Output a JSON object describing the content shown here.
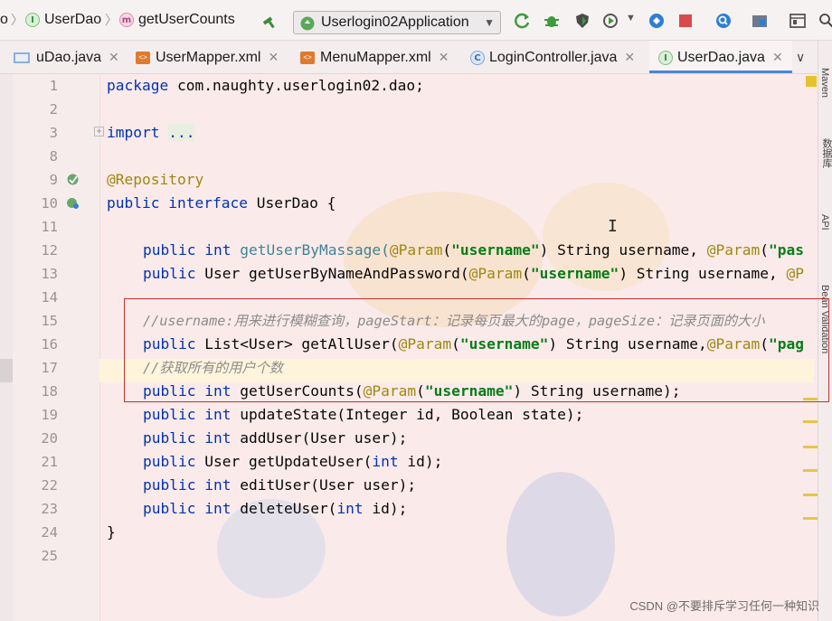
{
  "navbar": {
    "crumb_prefix": "o",
    "crumb_interface": "UserDao",
    "crumb_interface_icon": "I",
    "crumb_method": "getUserCounts",
    "crumb_method_icon": "m",
    "run_config": "Userlogin02Application"
  },
  "tabs": [
    {
      "label": "uDao.java",
      "icon": "java-file-icon"
    },
    {
      "label": "UserMapper.xml",
      "icon": "xml-file-icon"
    },
    {
      "label": "MenuMapper.xml",
      "icon": "xml-file-icon"
    },
    {
      "label": "LoginController.java",
      "icon": "class-icon",
      "icon_letter": "C"
    },
    {
      "label": "UserDao.java",
      "icon": "interface-icon",
      "icon_letter": "I"
    }
  ],
  "right_strip": {
    "maven": "Maven",
    "database": "数据库",
    "api": "API",
    "bean_validation": "Bean Validation"
  },
  "editor": {
    "line_numbers": [
      "1",
      "2",
      "3",
      "8",
      "9",
      "10",
      "11",
      "12",
      "13",
      "14",
      "15",
      "16",
      "17",
      "18",
      "19",
      "20",
      "21",
      "22",
      "23",
      "24",
      "25"
    ],
    "code": {
      "l1_kw": "package",
      "l1_rest": " com.naughty.userlogin02.dao;",
      "l3_kw": "import",
      "l3_fold": "...",
      "l9_ann": "@Repository",
      "l10_kw1": "public",
      "l10_kw2": "interface",
      "l10_rest": " UserDao {",
      "l12_kw1": "public",
      "l12_kw2": "int",
      "l12_method": "getUserByMassage(",
      "l12_ann": "@Param",
      "l12_p1": "(",
      "l12_str": "\"username\"",
      "l12_rest": ") String username, ",
      "l12_ann2": "@Param",
      "l12_p2": "(",
      "l12_str2": "\"pas",
      "l13_kw1": "public",
      "l13_rest1": " User getUserByNameAndPassword(",
      "l13_ann": "@Param",
      "l13_p1": "(",
      "l13_str": "\"username\"",
      "l13_rest2": ") String username, ",
      "l13_ann2": "@P",
      "l15_comment": "//username:用来进行模糊查询，pageStart：记录每页最大的page，pageSize：记录页面的大小",
      "l16_kw1": "public",
      "l16_rest1": " List<User> getAllUser(",
      "l16_ann": "@Param",
      "l16_p1": "(",
      "l16_str": "\"username\"",
      "l16_rest2": ") String username,",
      "l16_ann2": "@Param",
      "l16_p2": "(",
      "l16_str2": "\"pag",
      "l17_comment": "//获取所有的用户个数",
      "l18_kw1": "public",
      "l18_kw2": "int",
      "l18_method": " getUserCounts(",
      "l18_ann": "@Param",
      "l18_p1": "(",
      "l18_str": "\"username\"",
      "l18_rest": ") String username);",
      "l19_kw1": "public",
      "l19_kw2": "int",
      "l19_rest": " updateState(Integer id, Boolean state);",
      "l20_kw1": "public",
      "l20_kw2": "int",
      "l20_rest": " addUser(User user);",
      "l21_kw1": "public",
      "l21_rest1": " User getUpdateUser(",
      "l21_kw2": "int",
      "l21_rest2": " id);",
      "l22_kw1": "public",
      "l22_kw2": "int",
      "l22_rest": " editUser(User user);",
      "l23_kw1": "public",
      "l23_kw2": "int",
      "l23_rest1": " deleteUser(",
      "l23_kw3": "int",
      "l23_rest2": " id);",
      "l24": "}"
    }
  },
  "watermark": "CSDN @不要排斥学习任何一种知识",
  "colors": {
    "keyword": "#0033b3",
    "annotation": "#9e880d",
    "string": "#067d17",
    "comment": "#8c8c8c",
    "highlight_box": "#c0302a",
    "active_tab": "#4a86d8"
  }
}
